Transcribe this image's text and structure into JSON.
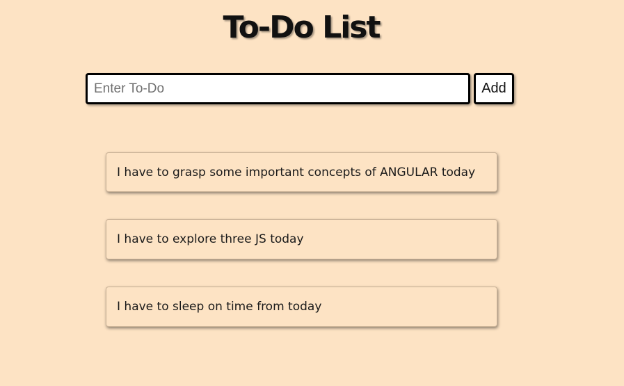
{
  "header": {
    "title": "To-Do List"
  },
  "form": {
    "input_value": "",
    "input_placeholder": "Enter To-Do",
    "add_label": "Add"
  },
  "todos": [
    {
      "text": "I have to grasp some important concepts of ANGULAR today"
    },
    {
      "text": "I have to explore three JS today"
    },
    {
      "text": "I have to sleep on time from today"
    }
  ],
  "colors": {
    "background": "#fde3c4",
    "border": "#000000",
    "text": "#111111"
  }
}
